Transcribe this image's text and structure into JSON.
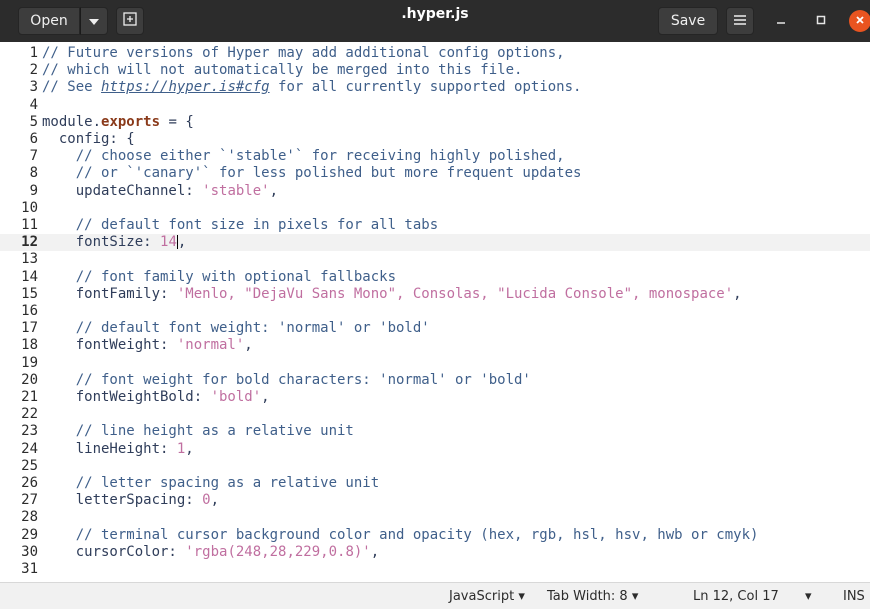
{
  "titlebar": {
    "open_label": "Open",
    "title": ".hyper.js",
    "save_label": "Save",
    "icons": [
      "chevron-down-icon",
      "new-tab-icon",
      "hamburger-menu-icon",
      "minimize-icon",
      "maximize-icon",
      "close-icon"
    ]
  },
  "editor": {
    "current_line": 12,
    "lines": [
      {
        "n": "1",
        "parts": [
          {
            "t": "// Future versions of Hyper may add additional config options,",
            "c": "c"
          }
        ]
      },
      {
        "n": "2",
        "parts": [
          {
            "t": "// which will not automatically be merged into this file.",
            "c": "c"
          }
        ]
      },
      {
        "n": "3",
        "parts": [
          {
            "t": "// See ",
            "c": "c"
          },
          {
            "t": "https://hyper.is#cfg",
            "c": "c u"
          },
          {
            "t": " for all currently supported options.",
            "c": "c"
          }
        ]
      },
      {
        "n": "4",
        "parts": []
      },
      {
        "n": "5",
        "parts": [
          {
            "t": "module.",
            "c": ""
          },
          {
            "t": "exports",
            "c": "k"
          },
          {
            "t": " = {",
            "c": ""
          }
        ]
      },
      {
        "n": "6",
        "parts": [
          {
            "t": "  config: {",
            "c": ""
          }
        ]
      },
      {
        "n": "7",
        "parts": [
          {
            "t": "    // choose either `'stable'` for receiving highly polished,",
            "c": "c"
          }
        ]
      },
      {
        "n": "8",
        "parts": [
          {
            "t": "    // or `'canary'` for less polished but more frequent updates",
            "c": "c"
          }
        ]
      },
      {
        "n": "9",
        "parts": [
          {
            "t": "    updateChannel: ",
            "c": ""
          },
          {
            "t": "'stable'",
            "c": "s"
          },
          {
            "t": ",",
            "c": ""
          }
        ]
      },
      {
        "n": "10",
        "parts": []
      },
      {
        "n": "11",
        "parts": [
          {
            "t": "    // default font size in pixels for all tabs",
            "c": "c"
          }
        ]
      },
      {
        "n": "12",
        "parts": [
          {
            "t": "    fontSize: ",
            "c": ""
          },
          {
            "t": "14",
            "c": "n"
          },
          {
            "t": ",",
            "c": ""
          }
        ]
      },
      {
        "n": "13",
        "parts": []
      },
      {
        "n": "14",
        "parts": [
          {
            "t": "    // font family with optional fallbacks",
            "c": "c"
          }
        ]
      },
      {
        "n": "15",
        "parts": [
          {
            "t": "    fontFamily: ",
            "c": ""
          },
          {
            "t": "'Menlo, \"DejaVu Sans Mono\", Consolas, \"Lucida Console\", monospace'",
            "c": "s"
          },
          {
            "t": ",",
            "c": ""
          }
        ]
      },
      {
        "n": "16",
        "parts": []
      },
      {
        "n": "17",
        "parts": [
          {
            "t": "    // default font weight: 'normal' or 'bold'",
            "c": "c"
          }
        ]
      },
      {
        "n": "18",
        "parts": [
          {
            "t": "    fontWeight: ",
            "c": ""
          },
          {
            "t": "'normal'",
            "c": "s"
          },
          {
            "t": ",",
            "c": ""
          }
        ]
      },
      {
        "n": "19",
        "parts": []
      },
      {
        "n": "20",
        "parts": [
          {
            "t": "    // font weight for bold characters: 'normal' or 'bold'",
            "c": "c"
          }
        ]
      },
      {
        "n": "21",
        "parts": [
          {
            "t": "    fontWeightBold: ",
            "c": ""
          },
          {
            "t": "'bold'",
            "c": "s"
          },
          {
            "t": ",",
            "c": ""
          }
        ]
      },
      {
        "n": "22",
        "parts": []
      },
      {
        "n": "23",
        "parts": [
          {
            "t": "    // line height as a relative unit",
            "c": "c"
          }
        ]
      },
      {
        "n": "24",
        "parts": [
          {
            "t": "    lineHeight: ",
            "c": ""
          },
          {
            "t": "1",
            "c": "n"
          },
          {
            "t": ",",
            "c": ""
          }
        ]
      },
      {
        "n": "25",
        "parts": []
      },
      {
        "n": "26",
        "parts": [
          {
            "t": "    // letter spacing as a relative unit",
            "c": "c"
          }
        ]
      },
      {
        "n": "27",
        "parts": [
          {
            "t": "    letterSpacing: ",
            "c": ""
          },
          {
            "t": "0",
            "c": "n"
          },
          {
            "t": ",",
            "c": ""
          }
        ]
      },
      {
        "n": "28",
        "parts": []
      },
      {
        "n": "29",
        "parts": [
          {
            "t": "    // terminal cursor background color and opacity (hex, rgb, hsl, hsv, hwb or cmyk)",
            "c": "c"
          }
        ]
      },
      {
        "n": "30",
        "parts": [
          {
            "t": "    cursorColor: ",
            "c": ""
          },
          {
            "t": "'rgba(248,28,229,0.8)'",
            "c": "s"
          },
          {
            "t": ",",
            "c": ""
          }
        ]
      },
      {
        "n": "31",
        "parts": []
      }
    ]
  },
  "statusbar": {
    "language": "JavaScript",
    "tab_width": "Tab Width: 8",
    "position": "Ln 12, Col 17",
    "mode": "INS"
  },
  "colors": {
    "titlebar_bg": "#2c2c2c",
    "close_button": "#e95420",
    "comment": "#3f5f8a",
    "string": "#c06fa0",
    "keyword": "#8a3a1a"
  }
}
